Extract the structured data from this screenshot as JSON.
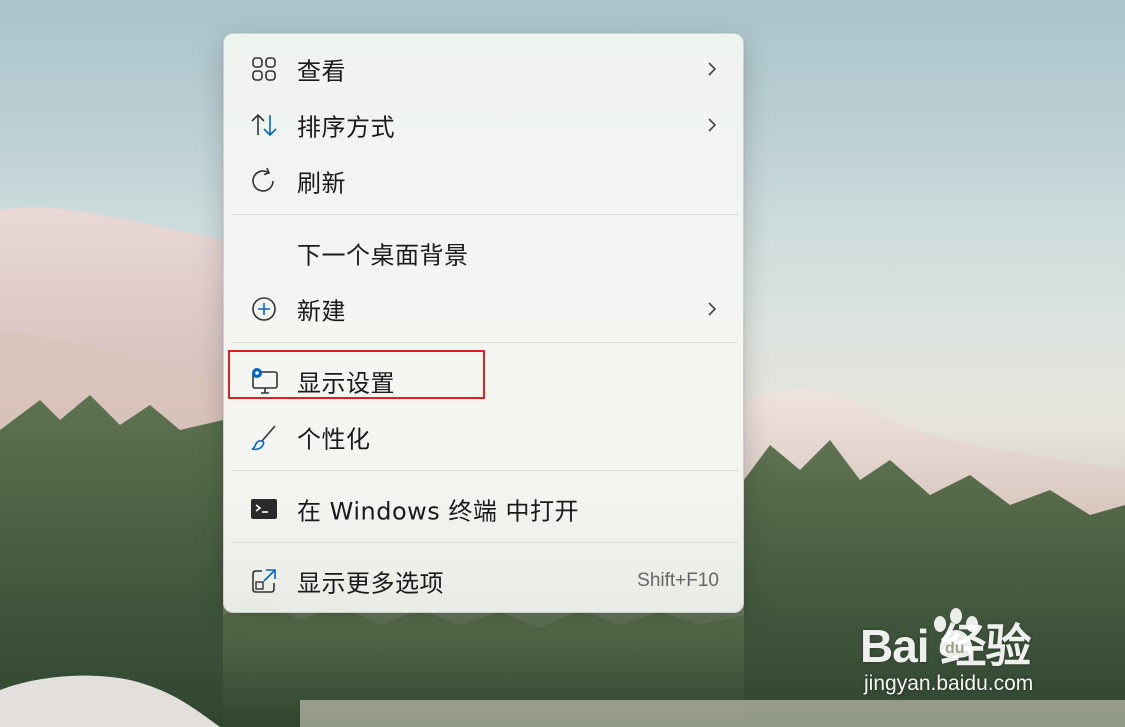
{
  "menu": {
    "items": [
      {
        "label": "查看",
        "icon": "view-grid-icon",
        "has_submenu": true
      },
      {
        "label": "排序方式",
        "icon": "sort-arrows-icon",
        "has_submenu": true
      },
      {
        "label": "刷新",
        "icon": "refresh-icon",
        "has_submenu": false
      },
      {
        "label": "下一个桌面背景",
        "icon": "",
        "has_submenu": false
      },
      {
        "label": "新建",
        "icon": "add-circle-icon",
        "has_submenu": true
      },
      {
        "label": "显示设置",
        "icon": "display-settings-icon",
        "has_submenu": false,
        "highlighted": true
      },
      {
        "label": "个性化",
        "icon": "brush-icon",
        "has_submenu": false
      },
      {
        "label": "在 Windows 终端 中打开",
        "icon": "terminal-icon",
        "has_submenu": false
      },
      {
        "label": "显示更多选项",
        "icon": "open-external-icon",
        "has_submenu": false,
        "shortcut": "Shift+F10"
      }
    ]
  },
  "watermark": {
    "brand": "Bai   经验",
    "url": "jingyan.baidu.com"
  },
  "colors": {
    "accent": "#0067c0",
    "highlight_border": "#e02020",
    "menu_background": "#f6f7f4"
  }
}
